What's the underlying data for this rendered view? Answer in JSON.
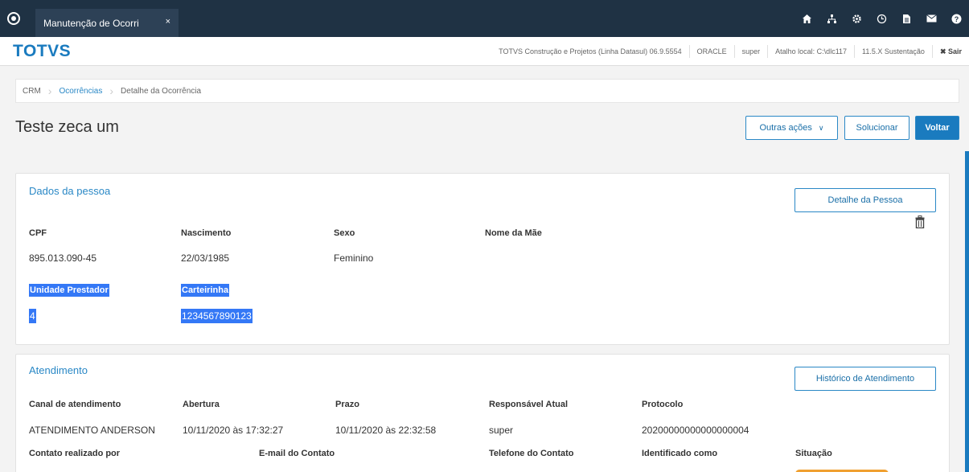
{
  "topbar": {
    "tab_label": "Manutenção de Ocorri",
    "tab_close": "×",
    "icons": [
      "home-icon",
      "sitemap-icon",
      "gear-icon",
      "clock-icon",
      "document-icon",
      "mail-icon",
      "help-icon"
    ]
  },
  "header": {
    "brand": "TOTVS",
    "product": "TOTVS Construção e Projetos (Linha Datasul) 06.9.5554",
    "database": "ORACLE",
    "user": "super",
    "shortcut": "Atalho local: C:\\dlc117",
    "version": "11.5.X Sustentação",
    "exit": "✖ Sair"
  },
  "breadcrumb": {
    "items": [
      "CRM",
      "Ocorrências",
      "Detalhe da Ocorrência"
    ]
  },
  "page": {
    "title": "Teste zeca um"
  },
  "actions": {
    "other_actions": "Outras ações",
    "solve": "Solucionar",
    "back": "Voltar"
  },
  "person": {
    "section_title": "Dados da pessoa",
    "detail_button": "Detalhe da Pessoa",
    "cpf_label": "CPF",
    "cpf_value": "895.013.090-45",
    "birth_label": "Nascimento",
    "birth_value": "22/03/1985",
    "sex_label": "Sexo",
    "sex_value": "Feminino",
    "mother_label": "Nome da Mãe",
    "unit_label": "Unidade Prestador",
    "unit_value": "4",
    "card_label": "Carteirinha",
    "card_value": "1234567890123"
  },
  "service": {
    "section_title": "Atendimento",
    "history_button": "Histórico de Atendimento",
    "channel_label": "Canal de atendimento",
    "channel_value": "ATENDIMENTO ANDERSON",
    "opening_label": "Abertura",
    "opening_value": "10/11/2020 às 17:32:27",
    "deadline_label": "Prazo",
    "deadline_value": "10/11/2020 às 22:32:58",
    "owner_label": "Responsável Atual",
    "owner_value": "super",
    "protocol_label": "Protocolo",
    "protocol_value": "20200000000000000004",
    "contact_by_label": "Contato realizado por",
    "contact_email_label": "E-mail do Contato",
    "contact_phone_label": "Telefone do Contato",
    "identified_label": "Identificado como",
    "status_label": "Situação",
    "status_color": "#f0a030"
  },
  "colors": {
    "topbar": "#1f3244",
    "accent": "#1a7bbf",
    "selection": "#3478f6"
  }
}
